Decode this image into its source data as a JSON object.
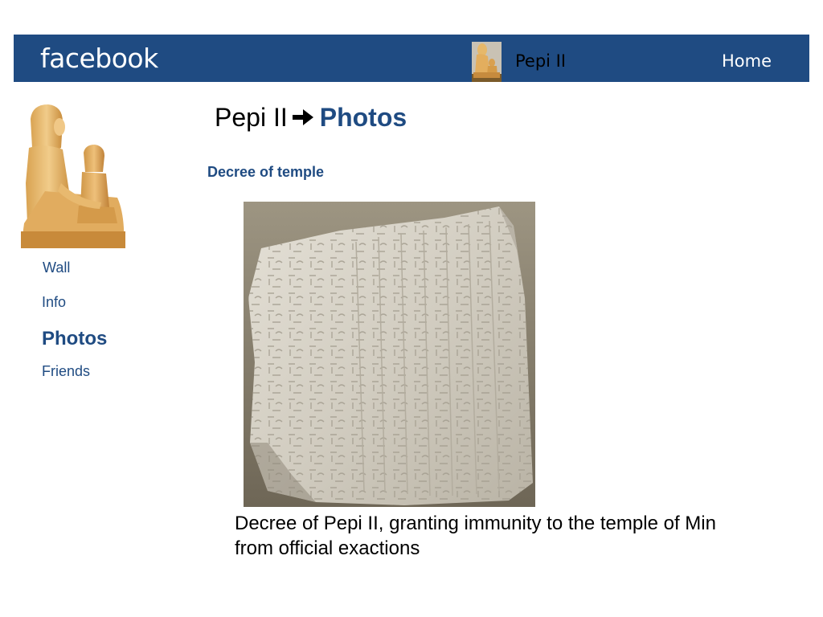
{
  "topbar": {
    "brand": "facebook",
    "profile_name": "Pepi II",
    "home_label": "Home"
  },
  "profile": {
    "avatar_icon": "seated-statue-image"
  },
  "sidenav": {
    "items": [
      {
        "label": "Wall",
        "active": false
      },
      {
        "label": "Info",
        "active": false
      },
      {
        "label": "Photos",
        "active": true
      },
      {
        "label": "Friends",
        "active": false
      }
    ]
  },
  "breadcrumb": {
    "profile_name": "Pepi II",
    "separator_icon": "arrow-right-icon",
    "current": "Photos"
  },
  "album": {
    "title": "Decree of temple"
  },
  "photo": {
    "image_icon": "stone-relief-image",
    "caption": "Decree of Pepi II, granting immunity to the temple of Min from official exactions"
  },
  "colors": {
    "brand_blue": "#1f4b82",
    "page_background": "#ffffff"
  }
}
